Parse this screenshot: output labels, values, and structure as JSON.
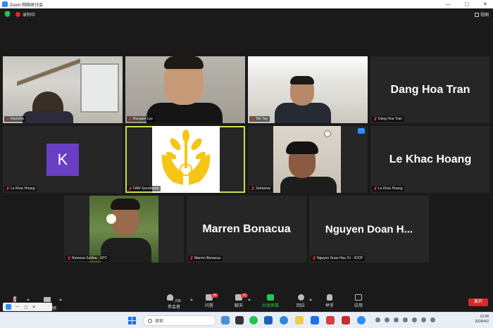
{
  "window": {
    "title": "Zoom 网络研讨会",
    "controls": [
      "—",
      "▢",
      "✕"
    ]
  },
  "meeting_bar": {
    "recording_label": "录制中",
    "view_label": "视图"
  },
  "participants": [
    {
      "name": "Ramsha",
      "type": "video"
    },
    {
      "name": "Baoqian Lyu",
      "type": "video"
    },
    {
      "name": "Tek Tay",
      "type": "video"
    },
    {
      "name": "Dang Hoa Tran",
      "type": "name",
      "display": "Dang Hoa Tran"
    },
    {
      "name": "Le Khac Hoang",
      "type": "avatar",
      "initial": "K"
    },
    {
      "name": "FAW Secretariat",
      "type": "logo",
      "active_speaker": true
    },
    {
      "name": "Zahtamal",
      "type": "video"
    },
    {
      "name": "Le Khac Hoang",
      "type": "name",
      "display": "Le Khac Hoang"
    },
    {
      "name": "Ramona Sulifoa - SPC",
      "type": "video"
    },
    {
      "name": "Marren Bonacua",
      "type": "name",
      "display": "Marren Bonacua"
    },
    {
      "name": "Nguyen Doan Huu Tri - IOOP",
      "type": "name",
      "display": "Nguyen  Doan  H..."
    }
  ],
  "toolbar": {
    "participants_label": "参会者",
    "participants_count": "238",
    "qa_label": "问答",
    "qa_badge": "30",
    "chat_label": "聊天",
    "chat_badge": "23",
    "share_label": "共享屏幕",
    "react_label": "回应",
    "raise_hand_label": "举手",
    "apps_label": "应用",
    "leave_label": "离开",
    "video_label": "频"
  },
  "taskbar": {
    "search_placeholder": "搜索",
    "time": "12:38",
    "date": "2024/4/2"
  },
  "colors": {
    "active_speaker": "#c9e14a",
    "avatar_purple": "#6b3fc3",
    "leave_red": "#d6292a",
    "share_green": "#23c552",
    "zoom_blue": "#2d8cff",
    "faw_logo_yellow": "#f5c518"
  }
}
